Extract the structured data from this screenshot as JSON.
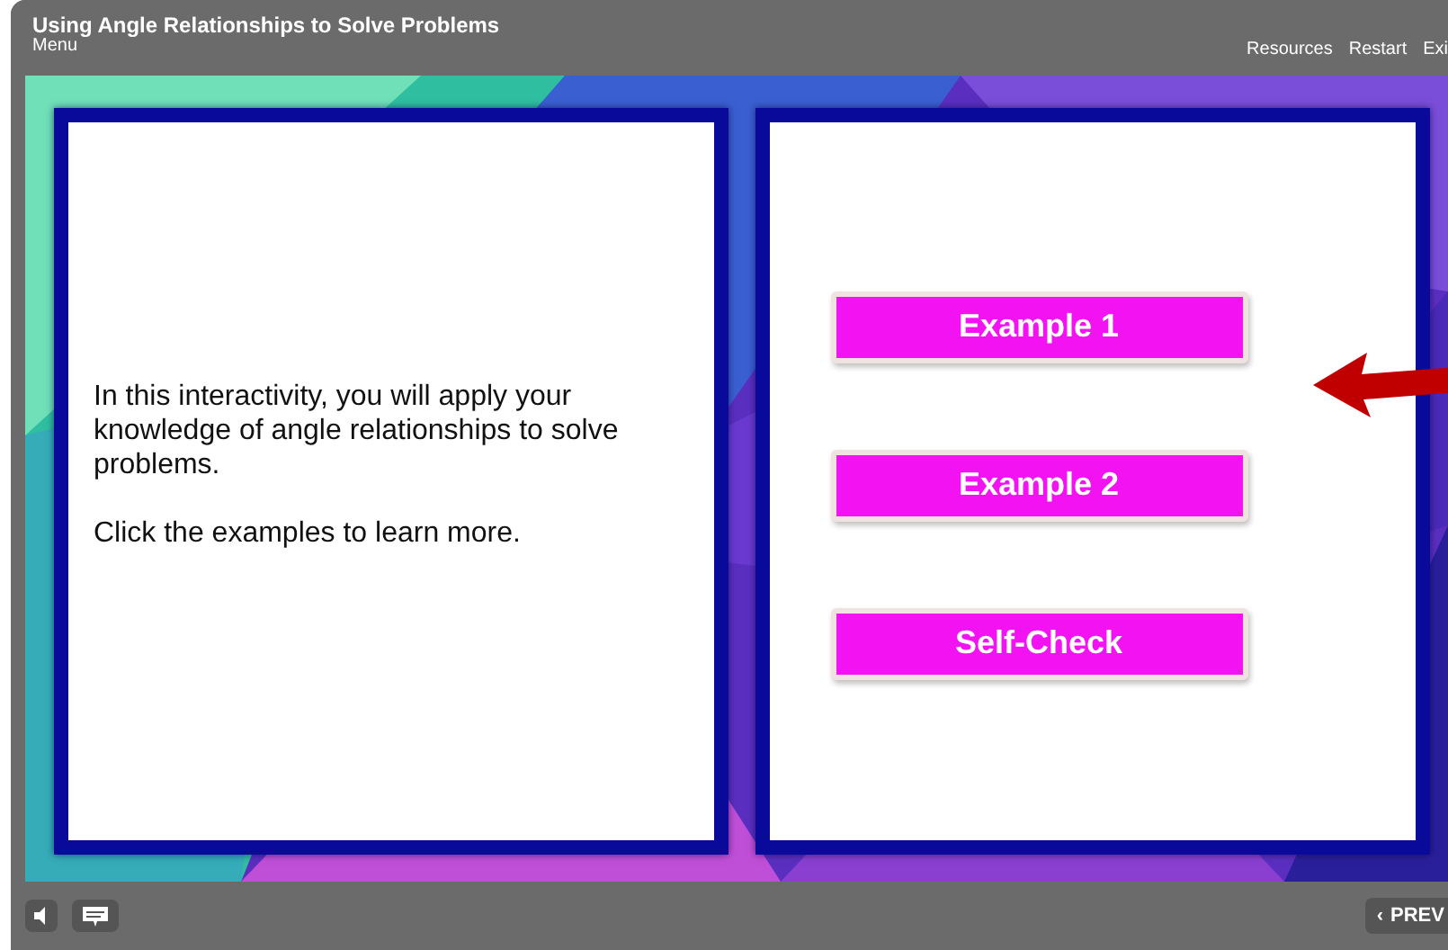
{
  "header": {
    "title": "Using Angle Relationships to Solve Problems",
    "menu": "Menu",
    "links": [
      "Resources",
      "Restart",
      "Exi"
    ]
  },
  "intro": {
    "paragraphs": [
      "In this interactivity, you will apply your knowledge of angle relationships to solve problems.",
      "Click the examples to learn more."
    ]
  },
  "choices": [
    "Example 1",
    "Example 2",
    "Self-Check"
  ],
  "footer": {
    "prev": "PREV",
    "prev_icon": "‹"
  }
}
